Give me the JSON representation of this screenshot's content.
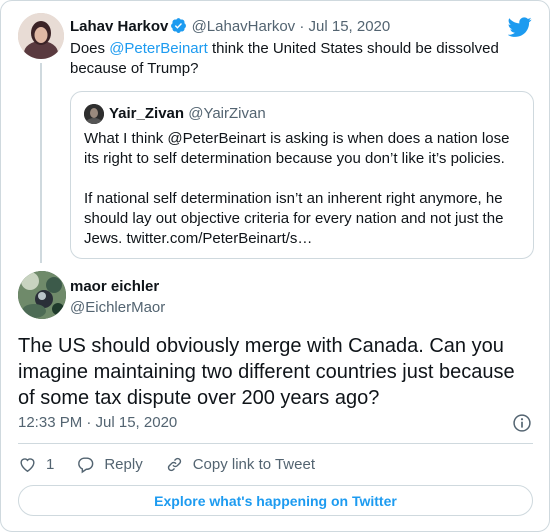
{
  "parent_tweet": {
    "author_name": "Lahav Harkov",
    "handle": "@LahavHarkov",
    "date": "Jul 15, 2020",
    "text_before": "Does ",
    "mention": "@PeterBeinart",
    "text_after": " think the United States should be dissolved because of Trump?",
    "verified_icon": "verified-badge-icon"
  },
  "quoted_tweet": {
    "author_name": "Yair_Zivan",
    "handle": "@YairZivan",
    "paragraph_1": "What I think @PeterBeinart is asking is when does a nation lose its right to self determination because you don’t like it’s policies.",
    "paragraph_2": "If national self determination isn’t an inherent right anymore, he should lay out objective criteria for every nation and not just the Jews. twitter.com/PeterBeinart/s…"
  },
  "main_tweet": {
    "author_name": "maor eichler",
    "handle": "@EichlerMaor",
    "text": "The US should obviously merge with Canada. Can you imagine maintaining two different countries just because of some tax dispute over 200 years ago?",
    "timestamp": "12:33 PM · Jul 15, 2020"
  },
  "actions": {
    "like_count": "1",
    "reply_label": "Reply",
    "copy_link_label": "Copy link to Tweet"
  },
  "explore_button": "Explore what's happening on Twitter",
  "colors": {
    "accent": "#1d9bf0",
    "text": "#0f1419",
    "muted": "#536471",
    "border": "#cfd9de"
  }
}
